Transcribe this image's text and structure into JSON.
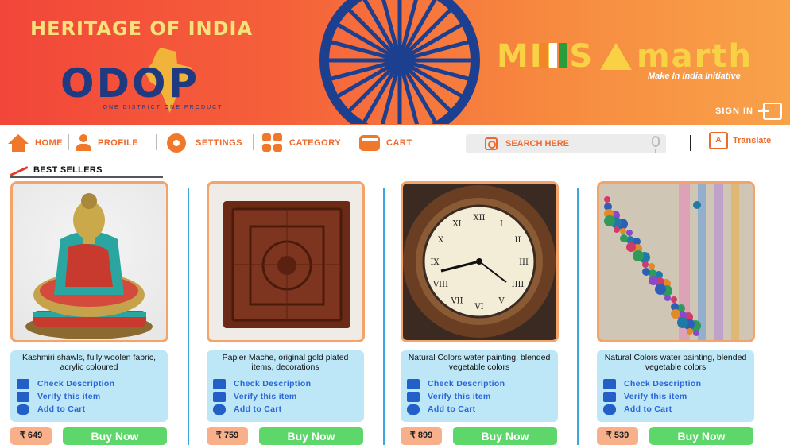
{
  "banner": {
    "heritage_title": "HERITAGE OF INDIA",
    "odop_logo_text": "ODOP",
    "odop_tagline": "ONE DISTRICT   ONE PRODUCT",
    "samarth_text": "M",
    "samarth_text_rest": "marth",
    "samarth_prefix": "MII S",
    "make_in_india": "Make In India Initiative",
    "sign_in": "SIGN IN",
    "colors": {
      "gradient_start": "#f2463a",
      "gradient_end": "#f8a24a",
      "chakra": "#1d3f8f",
      "gold": "#f8d145"
    }
  },
  "nav": {
    "items": [
      {
        "label": "HOME",
        "icon": "home-icon"
      },
      {
        "label": "PROFILE",
        "icon": "profile-icon"
      },
      {
        "label": "SETTINGS",
        "icon": "gear-icon"
      },
      {
        "label": "CATEGORY",
        "icon": "category-icon"
      },
      {
        "label": "CART",
        "icon": "cart-icon"
      }
    ],
    "search_placeholder": "SEARCH HERE",
    "translate_label": "Translate",
    "accent": "#ee6a2a"
  },
  "best_sellers": {
    "label": "BEST SELLERS"
  },
  "actions": {
    "check": "Check Description",
    "verify": "Verify this item",
    "add": "Add to Cart"
  },
  "products": [
    {
      "title": "Kashmiri shawls, fully woolen fabric, acrylic coloured",
      "price": "₹ 649",
      "buy": "Buy Now",
      "image": "buddha-statue"
    },
    {
      "title": "Papier Mache, original gold plated items, decorations",
      "price": "₹ 759",
      "buy": "Buy Now",
      "image": "carved-wooden-box"
    },
    {
      "title": "Natural Colors water painting, blended vegetable colors",
      "price": "₹ 899",
      "buy": "Buy Now",
      "image": "wall-clock"
    },
    {
      "title": "Natural Colors water painting, blended vegetable colors",
      "price": "₹ 539",
      "buy": "Buy Now",
      "image": "embroidered-shawl"
    }
  ]
}
